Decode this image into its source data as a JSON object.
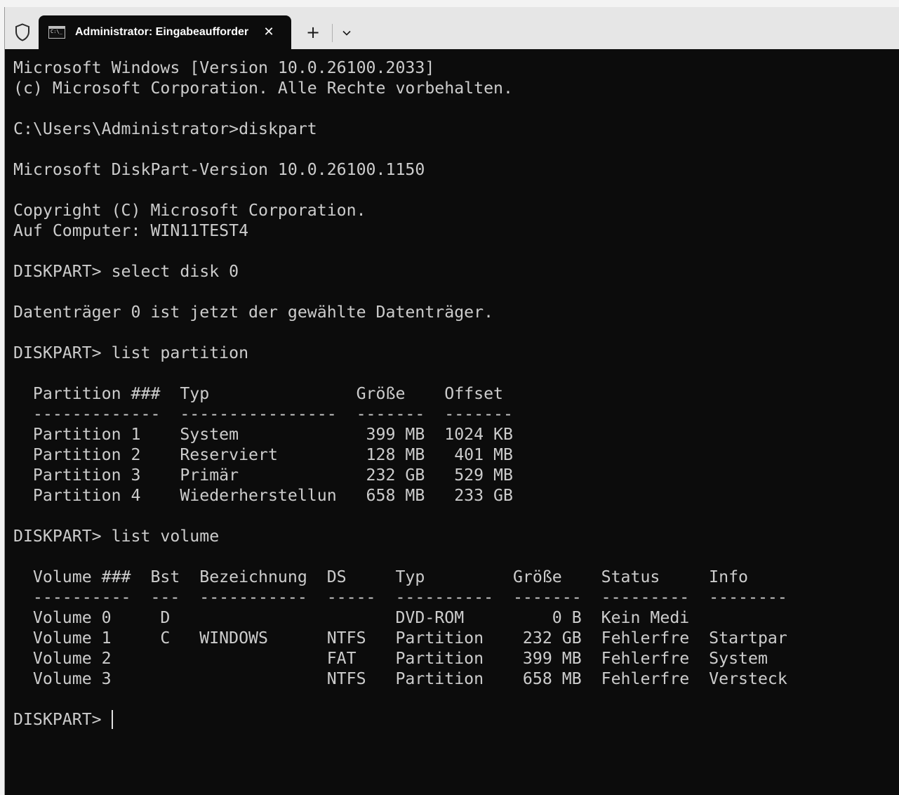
{
  "tab": {
    "title": "Administrator: Eingabeaufforderung",
    "icon_label": "C:\\_"
  },
  "titlebar": {
    "close_glyph": "✕",
    "new_tab_glyph": "+"
  },
  "icons": {
    "shield": "shield-icon",
    "terminal": "terminal-icon",
    "close": "close-icon",
    "new_tab": "plus-icon",
    "dropdown": "chevron-down-icon"
  },
  "colors": {
    "terminal_bg": "#0c0c0c",
    "terminal_fg": "#cccccc",
    "titlebar_bg": "#e6e6e6"
  },
  "terminal": {
    "lines": [
      "Microsoft Windows [Version 10.0.26100.2033]",
      "(c) Microsoft Corporation. Alle Rechte vorbehalten.",
      "",
      "C:\\Users\\Administrator>diskpart",
      "",
      "Microsoft DiskPart-Version 10.0.26100.1150",
      "",
      "Copyright (C) Microsoft Corporation.",
      "Auf Computer: WIN11TEST4",
      "",
      "DISKPART> select disk 0",
      "",
      "Datenträger 0 ist jetzt der gewählte Datenträger.",
      "",
      "DISKPART> list partition",
      "",
      "  Partition ###  Typ               Größe    Offset",
      "  -------------  ----------------  -------  -------",
      "  Partition 1    System             399 MB  1024 KB",
      "  Partition 2    Reserviert         128 MB   401 MB",
      "  Partition 3    Primär             232 GB   529 MB",
      "  Partition 4    Wiederherstellun   658 MB   233 GB",
      "",
      "DISKPART> list volume",
      "",
      "  Volume ###  Bst  Bezeichnung  DS     Typ         Größe    Status     Info",
      "  ----------  ---  -----------  -----  ----------  -------  ---------  --------",
      "  Volume 0     D                       DVD-ROM         0 B  Kein Medi",
      "  Volume 1     C   WINDOWS      NTFS   Partition    232 GB  Fehlerfre  Startpar",
      "  Volume 2                      FAT    Partition    399 MB  Fehlerfre  System",
      "  Volume 3                      NTFS   Partition    658 MB  Fehlerfre  Versteck",
      "",
      "DISKPART> "
    ]
  }
}
